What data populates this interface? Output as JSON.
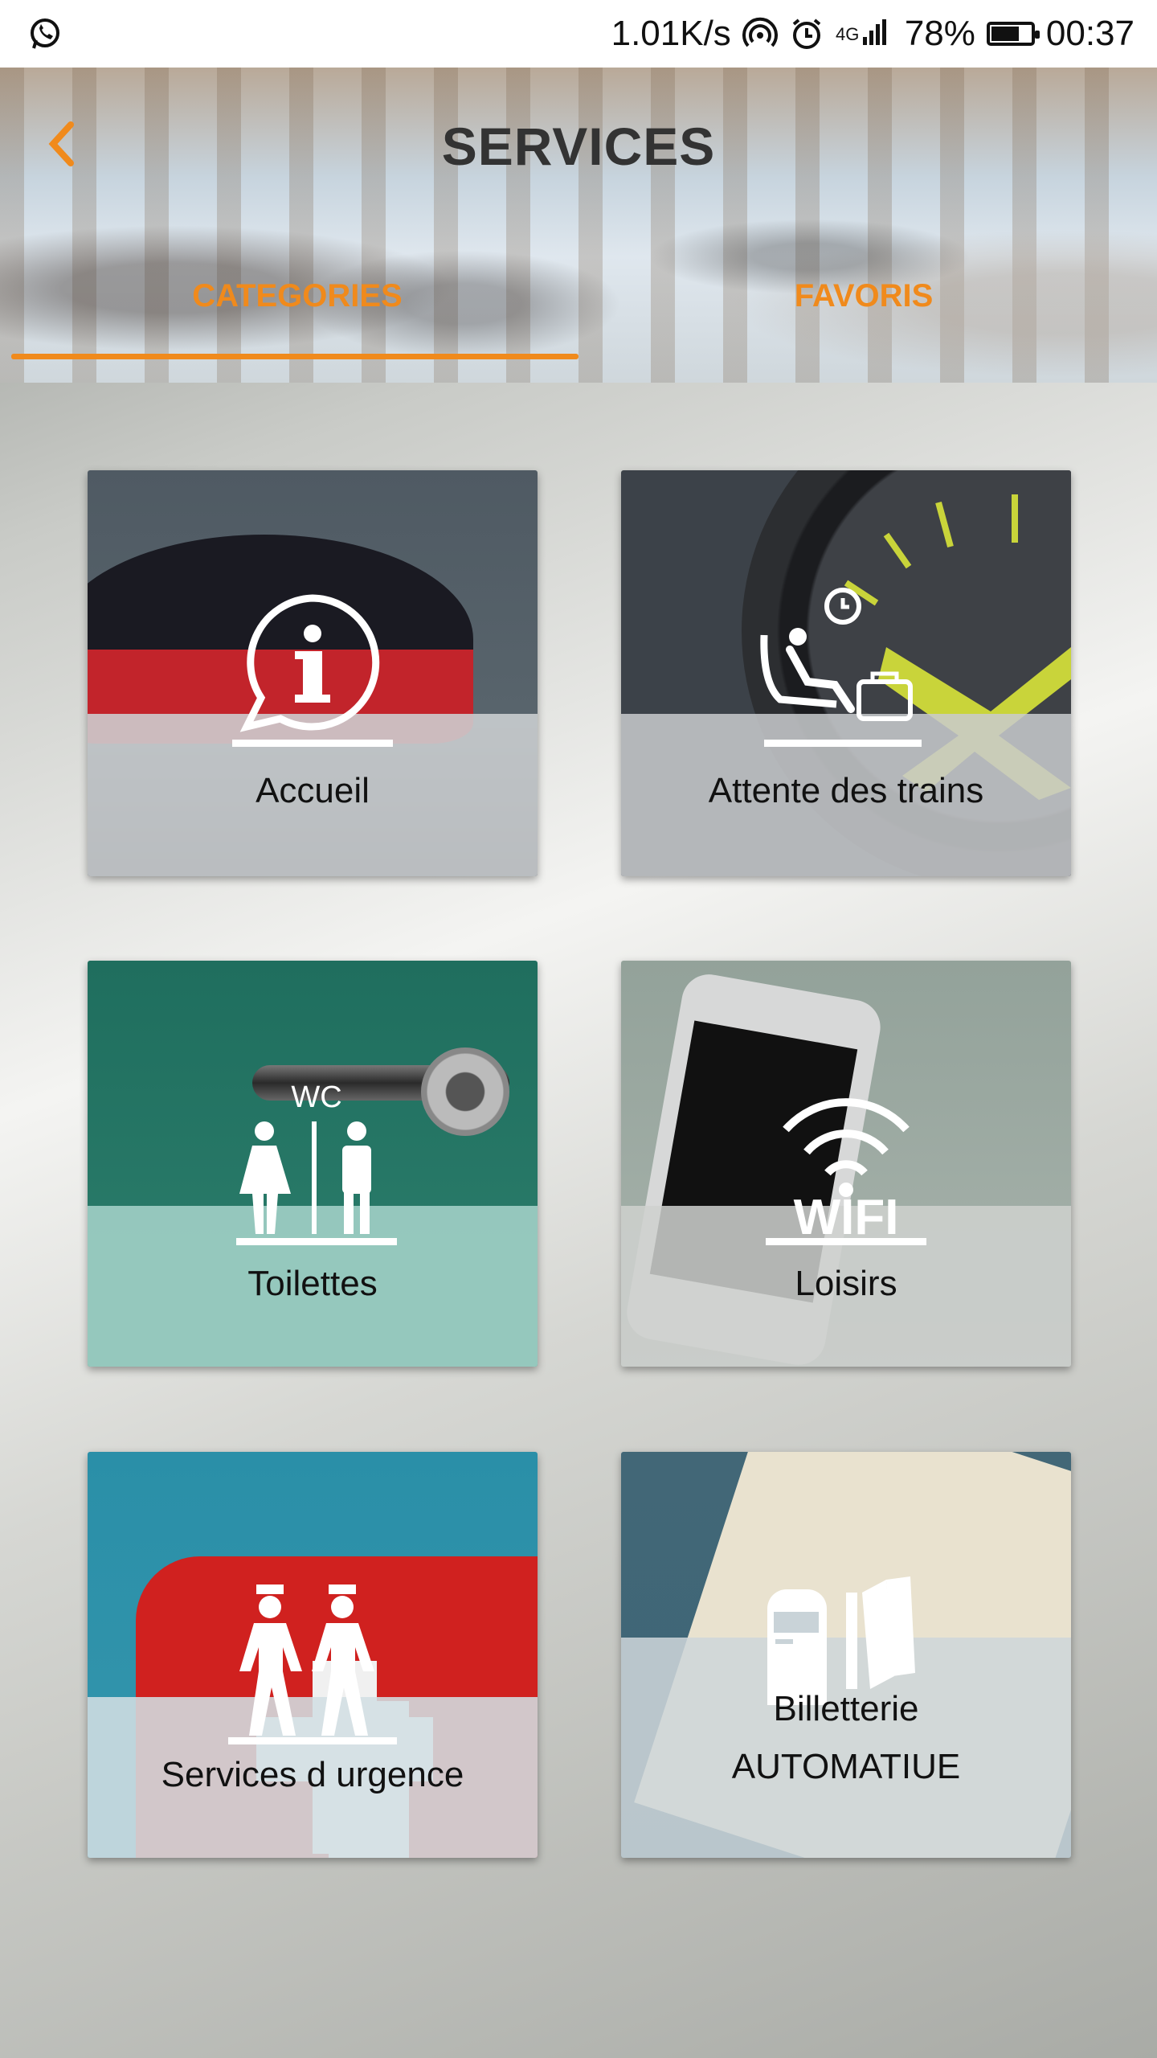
{
  "status_bar": {
    "net_speed": "1.01K/s",
    "network": "4G",
    "battery": "78%",
    "time": "00:37",
    "battery_level": 0.78
  },
  "header": {
    "title": "SERVICES",
    "tabs": [
      {
        "label": "CATEGORIES",
        "selected": true
      },
      {
        "label": "FAVORIS",
        "selected": false
      }
    ],
    "accent_color": "#f08a1c"
  },
  "categories": [
    {
      "label": "Accueil",
      "icon": "info-bubble-icon"
    },
    {
      "label": "Attente des trains",
      "icon": "waiting-seat-icon"
    },
    {
      "label": "Toilettes",
      "icon": "wc-icon"
    },
    {
      "label": "Loisirs",
      "icon": "wifi-icon"
    },
    {
      "label": "Services d urgence",
      "icon": "security-agents-icon"
    },
    {
      "label": "Billetterie AUTOMATIUE",
      "icon": "ticket-machine-icon"
    }
  ]
}
